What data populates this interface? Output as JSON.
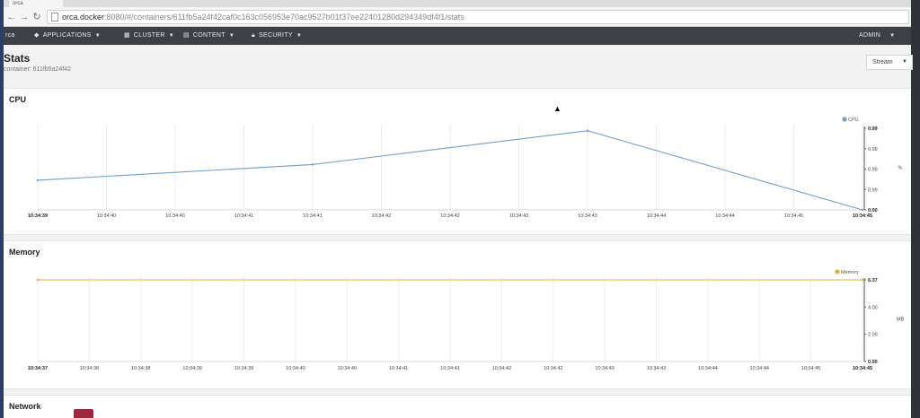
{
  "browser": {
    "tab_title": "orca",
    "url_host": "orca.docker",
    "url_path": ":8080/#/containers/611fb5a24f42caf0c163c056953e70ac9527b01f37ee22401280d294349df4f1/stats",
    "back_icon": "back-arrow-icon",
    "forward_icon": "forward-arrow-icon",
    "reload_icon": "reload-icon"
  },
  "navbar": {
    "brand": "rca",
    "applications": "APPLICATIONS",
    "cluster": "CLUSTER",
    "content": "CONTENT",
    "security": "SECURITY",
    "admin": "ADMIN"
  },
  "page": {
    "title": "Stats",
    "subtitle": "container: 611fb5a24f42",
    "stream_select": "Stream"
  },
  "panels": {
    "cpu": {
      "title": "CPU"
    },
    "memory": {
      "title": "Memory"
    },
    "network": {
      "title": "Network"
    }
  },
  "chart_data": [
    {
      "type": "line",
      "title": "CPU",
      "legend": [
        "CPU"
      ],
      "legend_position": "top-right",
      "color": "#6f9ec9",
      "ylabel": "%",
      "y_ticks": [
        "0.00",
        "0.99",
        "0.99",
        "0.99",
        "0.99"
      ],
      "ylim": [
        0.0,
        0.99
      ],
      "x_ticks": [
        "10:34:39",
        "10:34:40",
        "10:34:40",
        "10:34:41",
        "10:34:41",
        "10:34:42",
        "10:34:42",
        "10:34:43",
        "10:34:43",
        "10:34:44",
        "10:34:44",
        "10:34:45",
        "10:34:45"
      ],
      "series": [
        {
          "name": "CPU",
          "x": [
            0,
            4,
            8,
            12
          ],
          "values": [
            0.36,
            0.55,
            0.96,
            0.0
          ]
        }
      ]
    },
    {
      "type": "line",
      "title": "Memory",
      "legend": [
        "Memory"
      ],
      "legend_position": "top-right",
      "color": "#e8b030",
      "ylabel": "MB",
      "y_ticks": [
        "0.00",
        "2.00",
        "4.00",
        "6.37"
      ],
      "ylim": [
        0,
        6.37
      ],
      "x_ticks": [
        "10:34:37",
        "10:34:38",
        "10:34:38",
        "10:34:39",
        "10:34:39",
        "10:34:40",
        "10:34:40",
        "10:34:41",
        "10:34:41",
        "10:34:42",
        "10:34:42",
        "10:34:43",
        "10:34:43",
        "10:34:44",
        "10:34:44",
        "10:34:45",
        "10:34:45"
      ],
      "series": [
        {
          "name": "Memory",
          "x": [
            0,
            16
          ],
          "values": [
            6.37,
            6.37
          ]
        }
      ]
    }
  ]
}
